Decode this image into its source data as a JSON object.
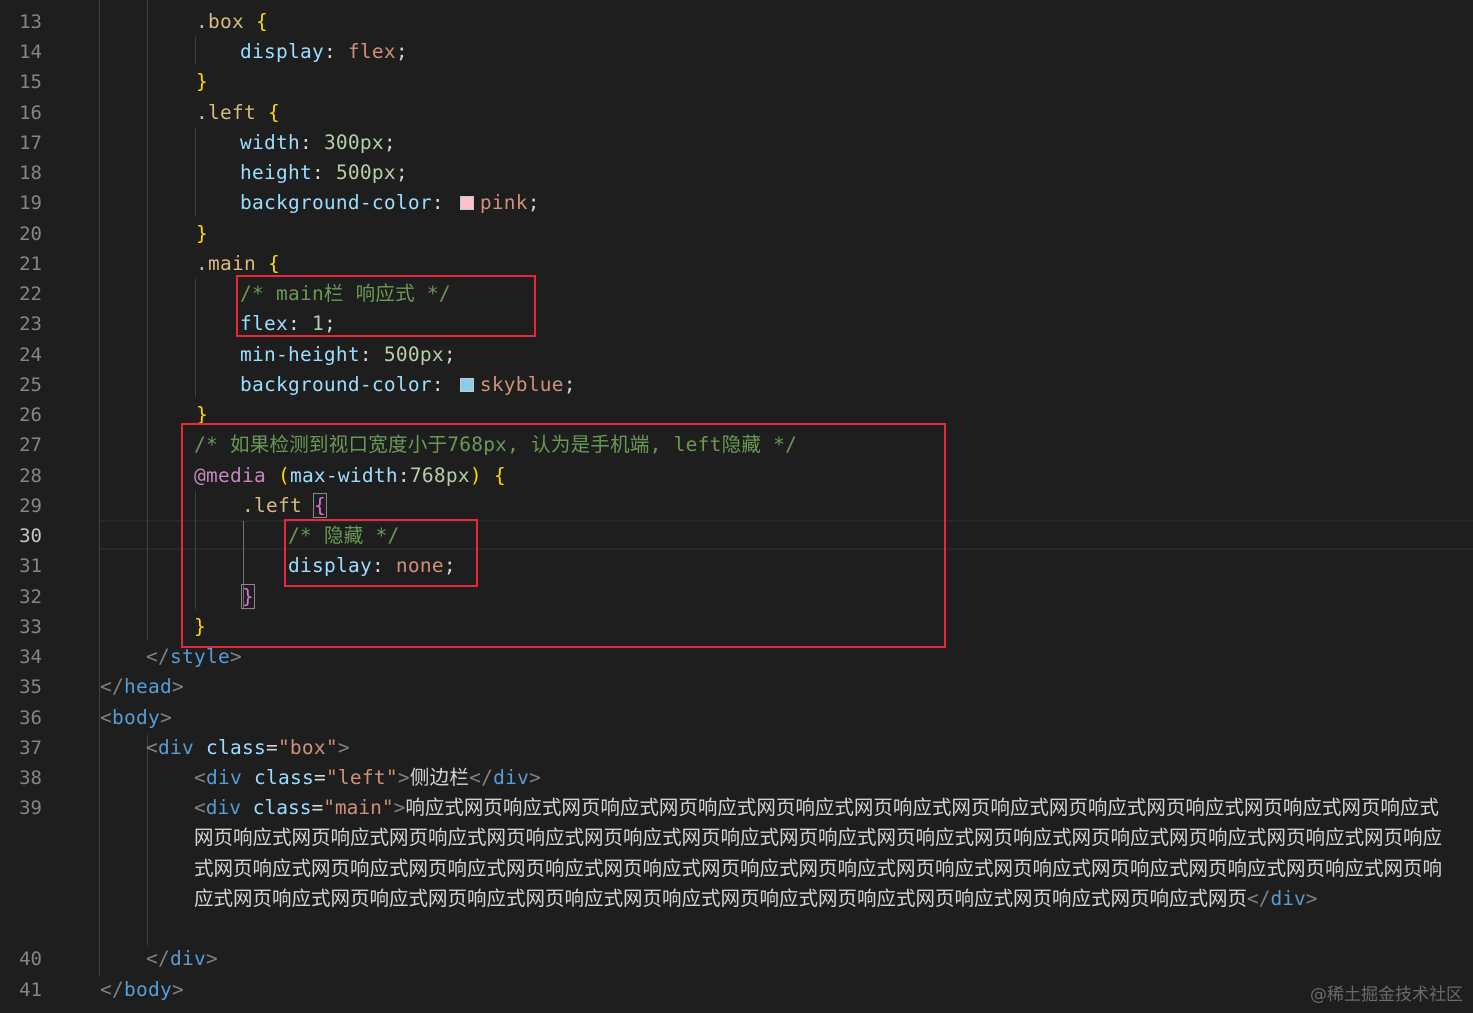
{
  "gutter": {
    "line_numbers": [
      "13",
      "14",
      "15",
      "16",
      "17",
      "18",
      "19",
      "20",
      "21",
      "22",
      "23",
      "24",
      "25",
      "26",
      "27",
      "28",
      "29",
      "30",
      "31",
      "32",
      "33",
      "34",
      "35",
      "36",
      "37",
      "38",
      "39",
      "40",
      "41"
    ],
    "active_line": "30"
  },
  "code": {
    "l13": {
      "sel": ".box",
      "brace": "{"
    },
    "l14": {
      "prop": "display",
      "val": "flex"
    },
    "l15": {
      "brace": "}"
    },
    "l16": {
      "sel": ".left",
      "brace": "{"
    },
    "l17": {
      "prop": "width",
      "val": "300px"
    },
    "l18": {
      "prop": "height",
      "val": "500px"
    },
    "l19": {
      "prop": "background-color",
      "val": "pink",
      "swatch_color": "#ffc0cb"
    },
    "l20": {
      "brace": "}"
    },
    "l21": {
      "sel": ".main",
      "brace": "{"
    },
    "l22": {
      "comment": "/* main栏 响应式 */"
    },
    "l23": {
      "prop": "flex",
      "val": "1"
    },
    "l24": {
      "prop": "min-height",
      "val": "500px"
    },
    "l25": {
      "prop": "background-color",
      "val": "skyblue",
      "swatch_color": "#87ceeb"
    },
    "l26": {
      "brace": "}"
    },
    "l27": {
      "comment": "/* 如果检测到视口宽度小于768px, 认为是手机端, left隐藏 */"
    },
    "l28": {
      "at": "@media",
      "open": "(",
      "feature": "max-width",
      "colon": ":",
      "val": "768px",
      "close": ")",
      "brace": "{"
    },
    "l29": {
      "sel": ".left",
      "brace": "{"
    },
    "l30": {
      "comment": "/* 隐藏 */"
    },
    "l31": {
      "prop": "display",
      "val": "none"
    },
    "l32": {
      "brace": "}"
    },
    "l33": {
      "brace": "}"
    },
    "l34": {
      "open": "</",
      "tag": "style",
      "close": ">"
    },
    "l35": {
      "open": "</",
      "tag": "head",
      "close": ">"
    },
    "l36": {
      "open": "<",
      "tag": "body",
      "close": ">"
    },
    "l37": {
      "open": "<",
      "tag": "div",
      "attr": "class",
      "eq": "=",
      "str": "\"box\"",
      "close": ">"
    },
    "l38": {
      "open": "<",
      "tag": "div",
      "attr": "class",
      "eq": "=",
      "str": "\"left\"",
      "close": ">",
      "text": "侧边栏",
      "end_open": "</",
      "end_tag": "div",
      "end_close": ">"
    },
    "l39": {
      "open": "<",
      "tag": "div",
      "attr": "class",
      "eq": "=",
      "str": "\"main\"",
      "close": ">",
      "text": "响应式网页响应式网页响应式网页响应式网页响应式网页响应式网页响应式网页响应式网页响应式网页响应式网页响应式网页响应式网页响应式网页响应式网页响应式网页响应式网页响应式网页响应式网页响应式网页响应式网页响应式网页响应式网页响应式网页响应式网页响应式网页响应式网页响应式网页响应式网页响应式网页响应式网页响应式网页响应式网页响应式网页响应式网页响应式网页响应式网页响应式网页响应式网页响应式网页响应式网页响应式网页响应式网页响应式网页响应式网页响应式网页响应式网页响应式网页",
      "end_open": "</",
      "end_tag": "div",
      "end_close": ">"
    },
    "l40": {
      "open": "</",
      "tag": "div",
      "close": ">"
    },
    "l41": {
      "open": "</",
      "tag": "body",
      "close": ">"
    }
  },
  "watermark": "@稀土掘金技术社区",
  "colors": {
    "background": "#1e1e1e",
    "annotation_box": "#e5283a",
    "comment": "#6a9955",
    "selector": "#d7ba7d",
    "property": "#9cdcfe",
    "value": "#ce9178",
    "tag": "#569cd6"
  }
}
